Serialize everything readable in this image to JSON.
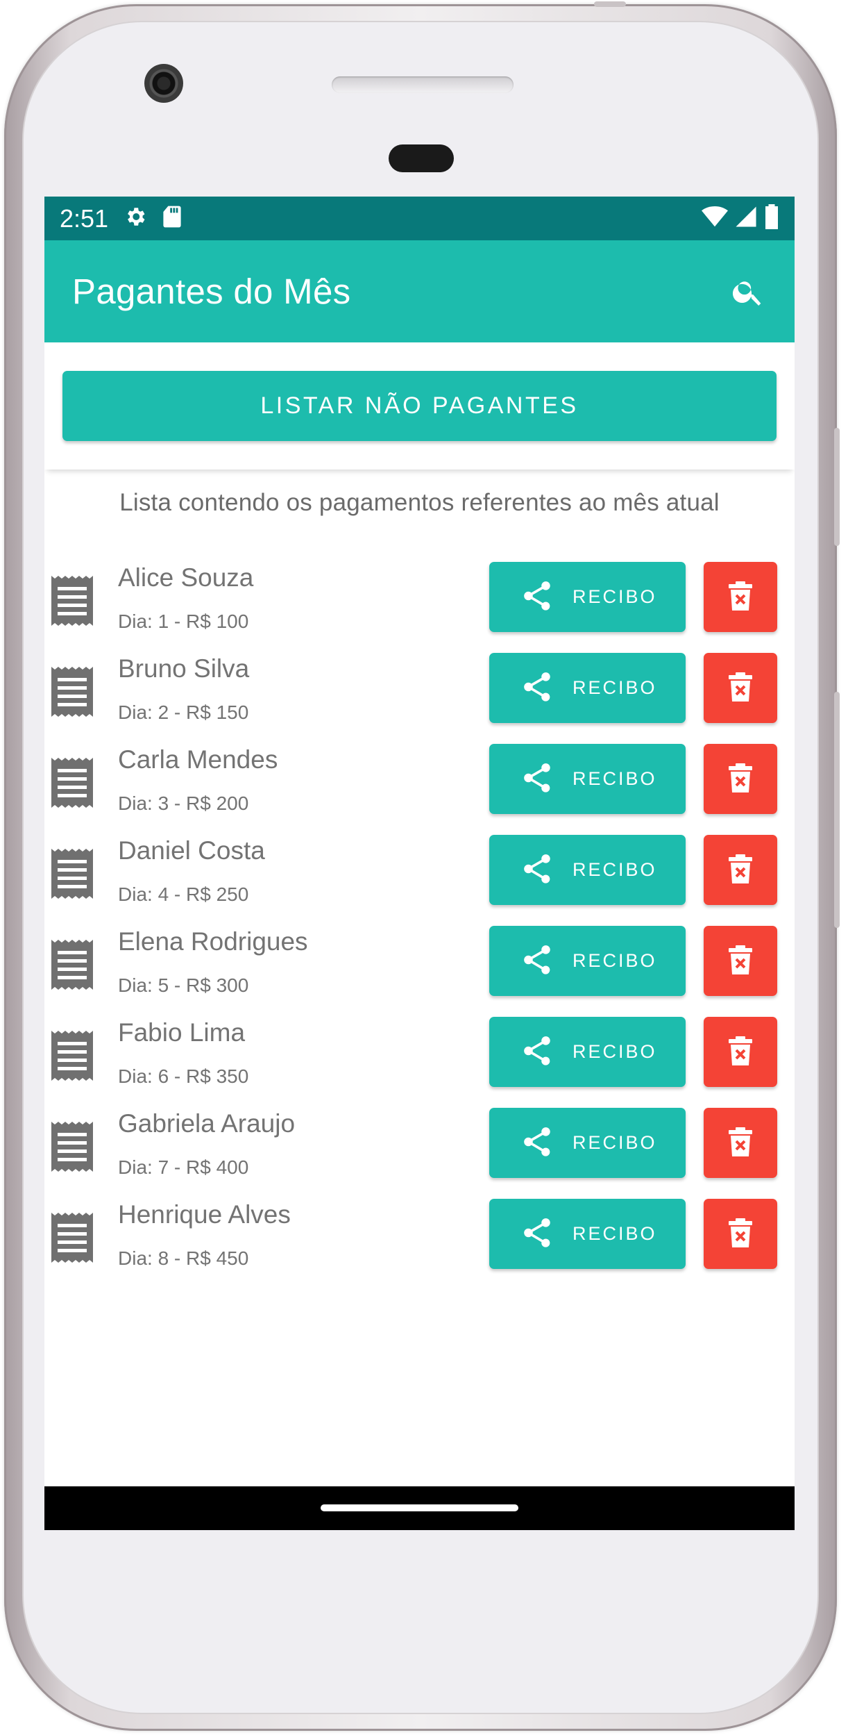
{
  "status_bar": {
    "time": "2:51",
    "left_icons": [
      "settings-icon",
      "sd-card-icon"
    ],
    "right_icons": [
      "wifi-icon",
      "cell-signal-icon",
      "battery-icon"
    ]
  },
  "app_bar": {
    "title": "Pagantes do Mês",
    "search_icon": "search-icon"
  },
  "actions": {
    "list_unpaid_label": "LISTAR NÃO PAGANTES"
  },
  "caption": "Lista contendo os pagamentos referentes ao mês atual",
  "payments": [
    {
      "name": "Alice Souza",
      "detail": "Dia: 1 - R$ 100",
      "receipt_label": "RECIBO"
    },
    {
      "name": "Bruno Silva",
      "detail": "Dia: 2 - R$ 150",
      "receipt_label": "RECIBO"
    },
    {
      "name": "Carla Mendes",
      "detail": "Dia: 3 - R$ 200",
      "receipt_label": "RECIBO"
    },
    {
      "name": "Daniel Costa",
      "detail": "Dia: 4 - R$ 250",
      "receipt_label": "RECIBO"
    },
    {
      "name": "Elena Rodrigues",
      "detail": "Dia: 5 - R$ 300",
      "receipt_label": "RECIBO"
    },
    {
      "name": "Fabio Lima",
      "detail": "Dia: 6 - R$ 350",
      "receipt_label": "RECIBO"
    },
    {
      "name": "Gabriela Araujo",
      "detail": "Dia: 7 - R$ 400",
      "receipt_label": "RECIBO"
    },
    {
      "name": "Henrique Alves",
      "detail": "Dia: 8 - R$ 450",
      "receipt_label": "RECIBO"
    }
  ],
  "colors": {
    "status_bar": "#08797a",
    "primary": "#1dbcad",
    "delete": "#f44336",
    "text_secondary": "#737373"
  }
}
